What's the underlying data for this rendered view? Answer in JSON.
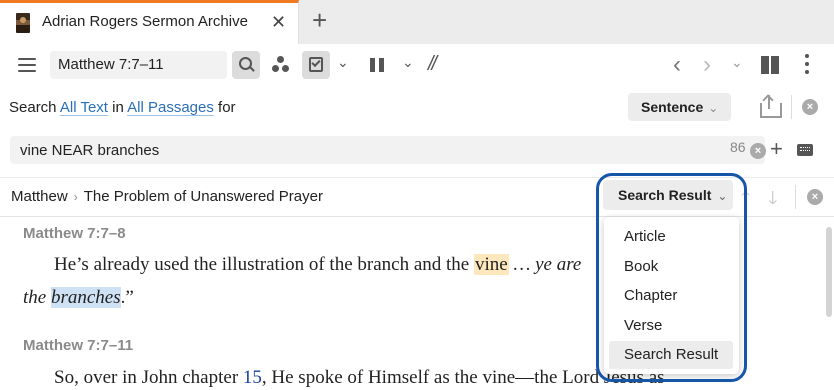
{
  "tab": {
    "title": "Adrian Rogers Sermon Archive",
    "close": "✕",
    "new_tab": "+"
  },
  "toolbar": {
    "reference": "Matthew 7:7–11",
    "dropdown_chevron": "⌄",
    "parallel_symbol": "//",
    "back": "‹",
    "forward": "›"
  },
  "search": {
    "prefix": "Search",
    "scope_text": "All Text",
    "in_word": "in",
    "scope_passages": "All Passages",
    "for_word": "for",
    "mode": "Sentence",
    "query": "vine NEAR branches",
    "result_count": "86"
  },
  "breadcrumb": {
    "book": "Matthew",
    "separator": "›",
    "title": "The Problem of Unanswered Prayer"
  },
  "result_type": {
    "selected": "Search Result",
    "options": [
      "Article",
      "Book",
      "Chapter",
      "Verse",
      "Search Result"
    ]
  },
  "results": [
    {
      "reference": "Matthew 7:7–8",
      "line1_pre": "He’s already used the illustration of the branch and the ",
      "line1_hit": "vine",
      "line1_post": " … ye are",
      "line2_pre": "the ",
      "line2_hit": "branches",
      "line2_post": ".”"
    },
    {
      "reference": "Matthew 7:7–11",
      "line1_pre": "So, over in John chapter ",
      "line1_num": "15",
      "line1_post": ", He spoke of Himself as the vine—the Lord Jesus as"
    }
  ],
  "icons": {
    "menu": "hamburger-icon",
    "search": "search-icon",
    "visual_filter": "dots-icon",
    "highlight": "checkbox-icon",
    "pause": "pause-icon",
    "panel": "panel-icon",
    "more": "more-vertical-icon",
    "share": "share-icon",
    "close": "close-circle-icon",
    "keyboard": "keyboard-icon"
  },
  "colors": {
    "accent": "#2a6fb8",
    "tab_accent": "#f07a22",
    "focus_ring": "#1556a8",
    "hit_vine": "#fde7bc",
    "hit_branches": "#cfe2f5"
  }
}
